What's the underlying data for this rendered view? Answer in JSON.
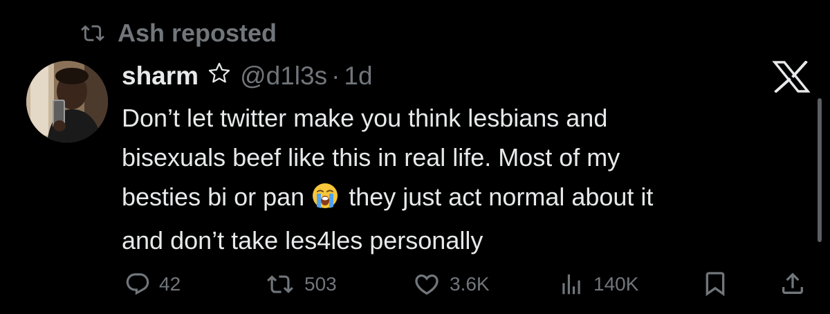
{
  "repost_label": "Ash reposted",
  "author": {
    "display_name": "sharm",
    "handle": "@d1l3s",
    "separator": "·",
    "time": "1d"
  },
  "tweet": {
    "lines": [
      "Don’t let twitter make you think lesbians and",
      "bisexuals beef like this in real life. Most of my",
      "they just act normal about it",
      "and don’t take les4les personally"
    ],
    "line3_prefix": "besties bi or pan",
    "emoji_icon": "loudly-crying-face-icon"
  },
  "stats": {
    "replies": "42",
    "reposts": "503",
    "likes": "3.6K",
    "views": "140K"
  },
  "colors": {
    "background": "#000000",
    "text": "#e7e9ea",
    "muted": "#71767b"
  }
}
